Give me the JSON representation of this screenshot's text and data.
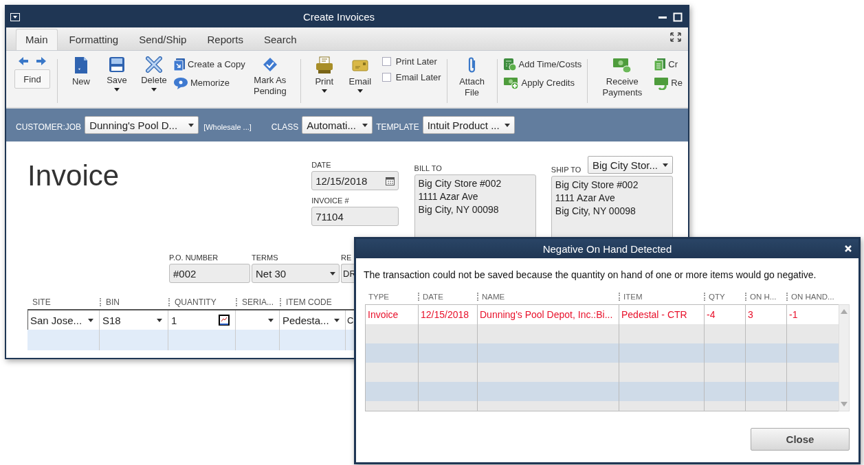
{
  "main_window": {
    "title": "Create Invoices",
    "tabs": [
      {
        "label": "Main",
        "selected": true
      },
      {
        "label": "Formatting",
        "selected": false
      },
      {
        "label": "Send/Ship",
        "selected": false
      },
      {
        "label": "Reports",
        "selected": false
      },
      {
        "label": "Search",
        "selected": false
      }
    ],
    "toolbar": {
      "find": "Find",
      "new": "New",
      "save": "Save",
      "delete": "Delete",
      "create_copy": "Create a Copy",
      "memorize": "Memorize",
      "mark_pending": "Mark As Pending",
      "print": "Print",
      "email": "Email",
      "print_later": {
        "label": "Print Later",
        "checked": false
      },
      "email_later": {
        "label": "Email Later",
        "checked": false
      },
      "attach": "Attach File",
      "add_time": "Add Time/Costs",
      "apply_credits": "Apply Credits",
      "receive": "Receive Payments",
      "cut_top": "Cr",
      "cut_bottom": "Re"
    },
    "header_bar": {
      "customer_label": "CUSTOMER:JOB",
      "customer": "Dunning's Pool D...",
      "customer_type": "[Wholesale ...]",
      "class_label": "CLASS",
      "class": "Automati...",
      "template_label": "TEMPLATE",
      "template": "Intuit Product ..."
    },
    "form": {
      "title": "Invoice",
      "date_label": "DATE",
      "date": "12/15/2018",
      "invoice_label": "INVOICE #",
      "invoice_no": "71104",
      "bill_to_label": "BILL TO",
      "bill_to": [
        "Big City Store #002",
        "1111 Azar Ave",
        "Big City, NY 00098"
      ],
      "ship_to_label": "SHIP TO",
      "ship_to_select": "Big City Stor...",
      "ship_to": [
        "Big City Store #002",
        "1111 Azar Ave",
        "Big City, NY 00098"
      ],
      "po_label": "P.O. NUMBER",
      "po": "#002",
      "terms_label": "TERMS",
      "terms": "Net 30",
      "rep_label": "RE",
      "rep": "DR"
    },
    "lines": {
      "columns": [
        "SITE",
        "BIN",
        "QUANTITY",
        "SERIA...",
        "ITEM CODE"
      ],
      "row": {
        "site": "San Jose...",
        "bin": "S18",
        "quantity": "1",
        "item": "Pedesta...",
        "column_6": "C"
      }
    }
  },
  "dialog": {
    "title": "Negative On Hand Detected",
    "message": "The transaction could not be saved because the quantity on hand of one or more items would go negative.",
    "columns": [
      "TYPE",
      "DATE",
      "NAME",
      "ITEM",
      "QTY",
      "ON H...",
      "ON HAND..."
    ],
    "rows": [
      [
        "Invoice",
        "12/15/2018",
        "Dunning's Pool Depot, Inc.:Bi...",
        "Pedestal - CTR",
        "-4",
        "3",
        "-1"
      ]
    ],
    "close": "Close"
  }
}
